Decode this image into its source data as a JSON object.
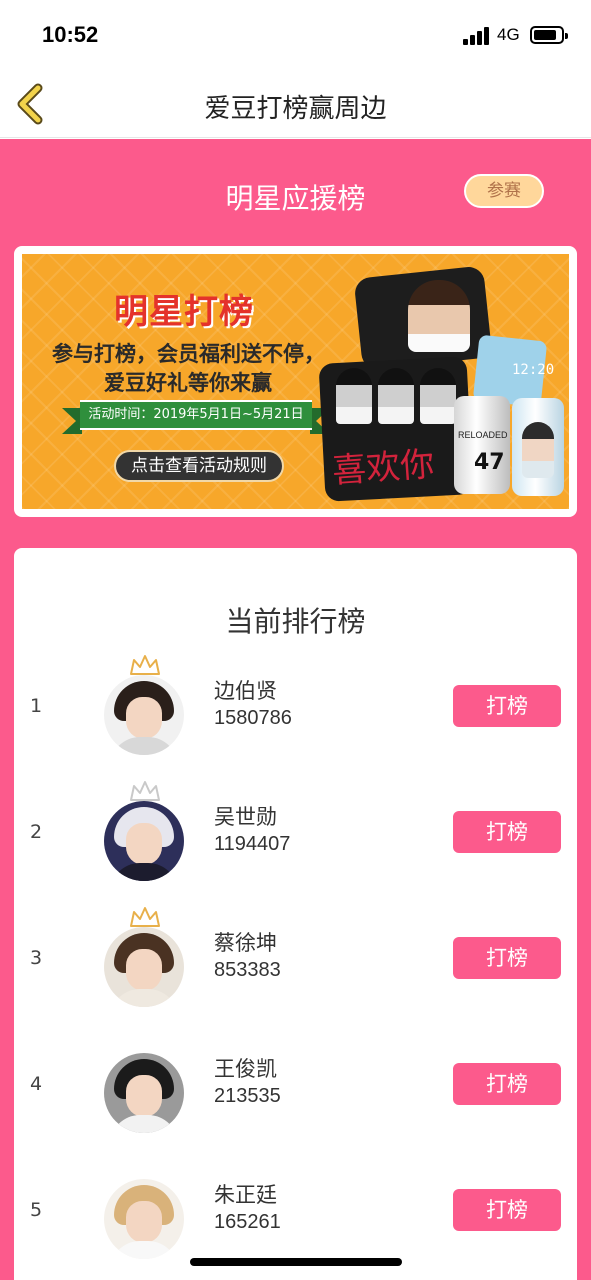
{
  "status_bar": {
    "time": "10:52",
    "network": "4G"
  },
  "nav": {
    "title": "爱豆打榜赢周边",
    "back_icon": "chevron-left-icon"
  },
  "header": {
    "title": "明星应援榜",
    "join_label": "参赛"
  },
  "banner": {
    "headline": "明星打榜",
    "line1": "参与打榜，会员福利送不停，",
    "line2": "爱豆好礼等你来赢",
    "activity_time": "活动时间：2019年5月1日~5月21日",
    "rules_button": "点击查看活动规则",
    "pillow_script": "喜欢你",
    "can_text": "RELOADED",
    "can_logo": "47",
    "cube_text": "12:20"
  },
  "ranking": {
    "title": "当前排行榜",
    "vote_label": "打榜",
    "items": [
      {
        "rank": "1",
        "name": "边伯贤",
        "votes": "1580786",
        "crown": "gold"
      },
      {
        "rank": "2",
        "name": "吴世勋",
        "votes": "1194407",
        "crown": "silver"
      },
      {
        "rank": "3",
        "name": "蔡徐坤",
        "votes": "853383",
        "crown": "gold"
      },
      {
        "rank": "4",
        "name": "王俊凯",
        "votes": "213535",
        "crown": "none"
      },
      {
        "rank": "5",
        "name": "朱正廷",
        "votes": "165261",
        "crown": "none"
      }
    ]
  },
  "colors": {
    "primary_pink": "#fc5a8c",
    "join_badge": "#ffd79b",
    "banner_orange": "#f7a72a",
    "crown_gold": "#e8b04a",
    "crown_silver": "#c9c9c9"
  }
}
